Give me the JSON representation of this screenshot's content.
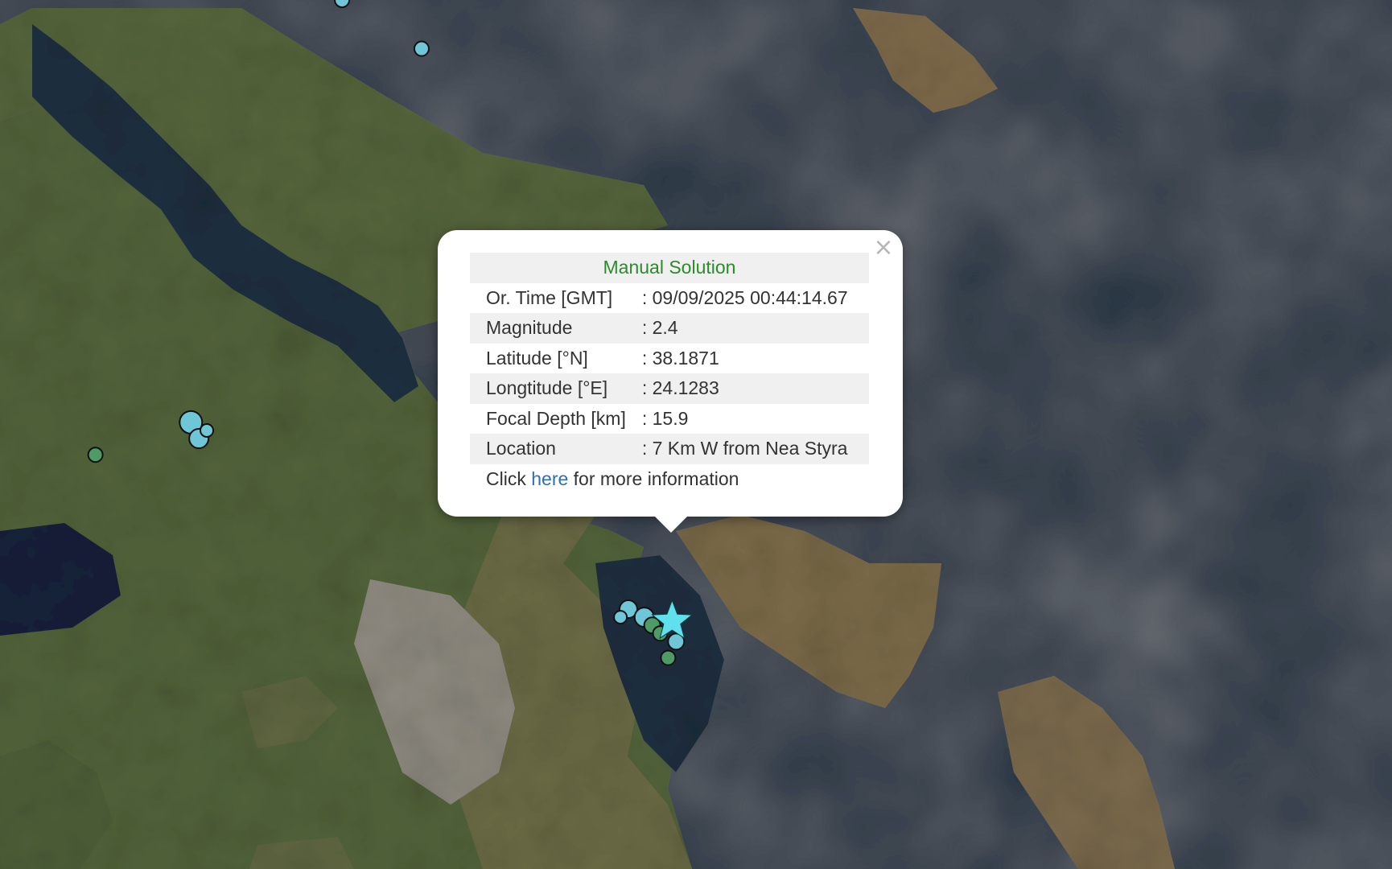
{
  "map": {
    "colors": {
      "sea": "#1c2d3d",
      "land": "#5b6a3c",
      "land_dry": "#8a7552",
      "city": "#9a948a",
      "marker_cyan": "#6fc6d6",
      "marker_green": "#4f9b67",
      "star": "#5fe0ec"
    },
    "markers": [
      {
        "lon": 23.26,
        "lat": 38.93,
        "color": "cyan",
        "size": 9
      },
      {
        "lon": 23.16,
        "lat": 38.99,
        "color": "cyan",
        "size": 9
      },
      {
        "lon": 22.97,
        "lat": 38.47,
        "color": "cyan",
        "size": 14
      },
      {
        "lon": 22.98,
        "lat": 38.45,
        "color": "cyan",
        "size": 12
      },
      {
        "lon": 22.99,
        "lat": 38.46,
        "color": "cyan",
        "size": 8
      },
      {
        "lon": 22.85,
        "lat": 38.43,
        "color": "green",
        "size": 9
      },
      {
        "lon": 23.52,
        "lat": 38.24,
        "color": "cyan",
        "size": 11
      },
      {
        "lon": 23.54,
        "lat": 38.23,
        "color": "cyan",
        "size": 12
      },
      {
        "lon": 23.51,
        "lat": 38.23,
        "color": "cyan",
        "size": 8
      },
      {
        "lon": 23.55,
        "lat": 38.22,
        "color": "green",
        "size": 10
      },
      {
        "lon": 23.56,
        "lat": 38.21,
        "color": "green",
        "size": 9
      },
      {
        "lon": 23.58,
        "lat": 38.2,
        "color": "cyan",
        "size": 10
      },
      {
        "lon": 23.57,
        "lat": 38.18,
        "color": "green",
        "size": 9
      }
    ],
    "selected_event": {
      "lon": 23.575,
      "lat": 38.225,
      "symbol": "star-icon"
    }
  },
  "popup": {
    "title": "Manual Solution",
    "rows": [
      {
        "label": "Or. Time [GMT]",
        "value": ": 09/09/2025 00:44:14.67"
      },
      {
        "label": "Magnitude",
        "value": ": 2.4"
      },
      {
        "label": "Latitude [°N]",
        "value": ": 38.1871"
      },
      {
        "label": "Longtitude [°E]",
        "value": ": 24.1283"
      },
      {
        "label": "Focal Depth [km]",
        "value": ": 15.9"
      },
      {
        "label": "Location",
        "value": ": 7 Km W from Nea Styra"
      }
    ],
    "footer": {
      "prefix": "Click ",
      "link": "here",
      "suffix": " for more information"
    },
    "close_icon": "close-icon",
    "close_glyph": "×"
  }
}
